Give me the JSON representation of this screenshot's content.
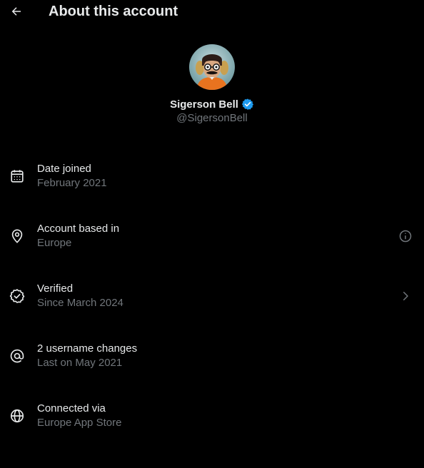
{
  "header": {
    "title": "About this account",
    "back_icon": "arrow-left-icon"
  },
  "profile": {
    "display_name": "Sigerson Bell",
    "handle": "@SigersonBell",
    "verified_badge_color": "#1d9bf0",
    "avatar_icon": "profile-avatar"
  },
  "rows": [
    {
      "icon": "calendar-icon",
      "title": "Date joined",
      "subtitle": "February 2021"
    },
    {
      "icon": "location-pin-icon",
      "title": "Account based in",
      "subtitle": "Europe",
      "action_icon": "info-circle-icon"
    },
    {
      "icon": "verified-seal-icon",
      "title": "Verified",
      "subtitle": "Since March 2024",
      "action_icon": "chevron-right-icon"
    },
    {
      "icon": "at-sign-icon",
      "title": "2 username changes",
      "subtitle": "Last on May 2021"
    },
    {
      "icon": "globe-icon",
      "title": "Connected via",
      "subtitle": "Europe App Store"
    }
  ],
  "colors": {
    "background": "#000000",
    "primary_text": "#e7e9ea",
    "secondary_text": "#71767b"
  }
}
